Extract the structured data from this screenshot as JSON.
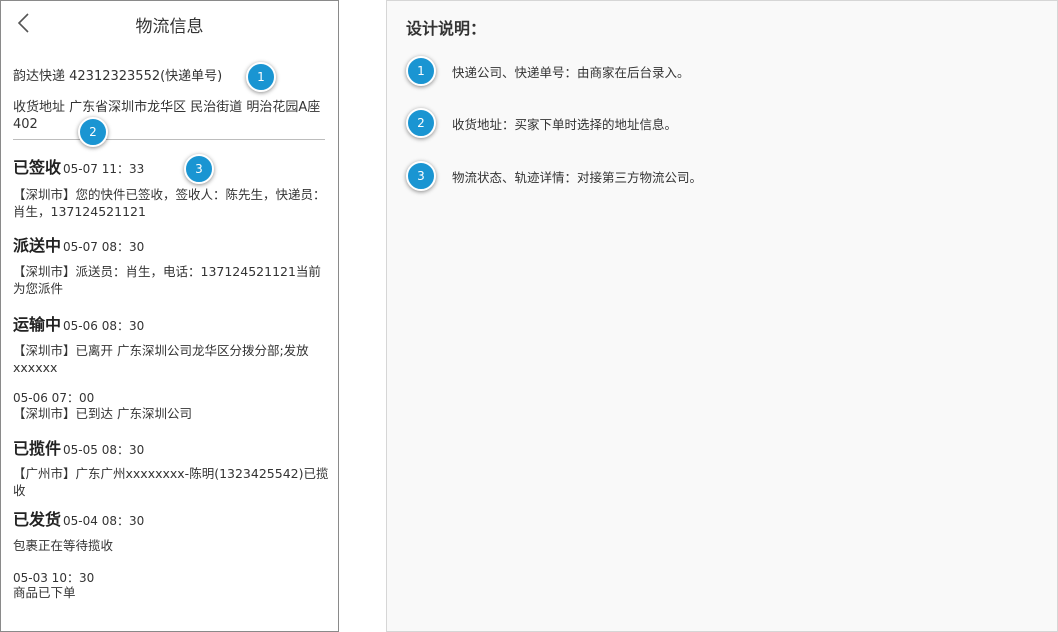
{
  "header": {
    "title": "物流信息",
    "back_icon": "chevron-left-icon"
  },
  "shipment": {
    "courier_line": "韵达快递  42312323552(快递单号)",
    "address_line": "收货地址  广东省深圳市龙华区 民治街道 明治花园A座402"
  },
  "timeline": [
    {
      "status": "已签收",
      "time": "05-07 11：33",
      "detail": "【深圳市】您的快件已签收，签收人：陈先生，快递员：肖生，137124521121"
    },
    {
      "status": "派送中",
      "time": "05-07 08：30",
      "detail": "【深圳市】派送员：肖生，电话：137124521121当前为您派件"
    },
    {
      "status": "运输中",
      "time": "05-06 08：30",
      "detail": "【深圳市】已离开 广东深圳公司龙华区分拨分部;发放 xxxxxx"
    },
    {
      "status": "",
      "time": "05-06 07：00",
      "detail": "【深圳市】已到达 广东深圳公司"
    },
    {
      "status": "已揽件",
      "time": "05-05 08：30",
      "detail": "【广州市】广东广州xxxxxxxx-陈明(1323425542)已揽收"
    },
    {
      "status": "已发货",
      "time": "05-04 08：30",
      "detail": "包裹正在等待揽收"
    },
    {
      "status": "",
      "time": "05-03 10：30",
      "detail": "商品已下单"
    }
  ],
  "badges": [
    "1",
    "2",
    "3"
  ],
  "design_notes": {
    "title": "设计说明：",
    "items": [
      {
        "num": "1",
        "text": "快递公司、快递单号：由商家在后台录入。"
      },
      {
        "num": "2",
        "text": "收货地址：买家下单时选择的地址信息。"
      },
      {
        "num": "3",
        "text": "物流状态、轨迹详情：对接第三方物流公司。"
      }
    ]
  },
  "colors": {
    "badge": "#1a95d2",
    "panel_bg": "#f9f9f9",
    "divider": "#bdbdbd"
  }
}
